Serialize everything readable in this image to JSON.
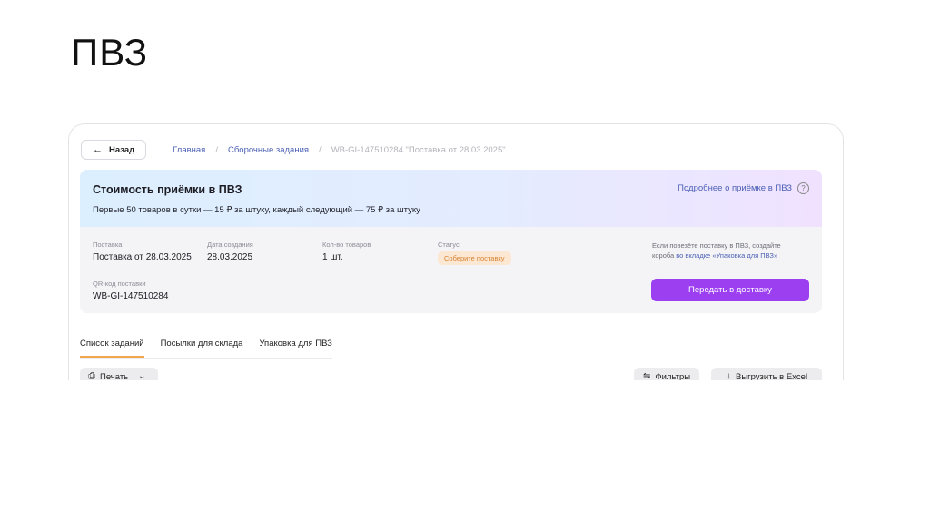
{
  "slide": {
    "title": "ПВЗ"
  },
  "header": {
    "back_label": "Назад",
    "breadcrumbs": [
      "Главная",
      "Сборочные задания",
      "WB-GI-147510284 \"Поставка от 28.03.2025\""
    ],
    "separator": "/"
  },
  "banner": {
    "title": "Стоимость приёмки в ПВЗ",
    "subtitle": "Первые 50 товаров в сутки — 15 ₽ за штуку, каждый следующий — 75 ₽ за штуку",
    "more_link": "Подробнее о приёмке в ПВЗ",
    "help_glyph": "?"
  },
  "details": {
    "supply": {
      "label": "Поставка",
      "value": "Поставка от 28.03.2025"
    },
    "created": {
      "label": "Дата создания",
      "value": "28.03.2025"
    },
    "quantity": {
      "label": "Кол-во товаров",
      "value": "1 шт."
    },
    "status": {
      "label": "Статус",
      "value": "Соберите поставку",
      "color": "#d6822f"
    },
    "qr": {
      "label": "QR-код поставки",
      "value": "WB-GI-147510284"
    }
  },
  "hint": {
    "text_before": "Если повезёте поставку в ПВЗ, создайте короба ",
    "link": "во вкладке «Упаковка для ПВЗ»"
  },
  "actions": {
    "send_label": "Передать в доставку",
    "print_label": "Печать",
    "filter_label": "Фильтры",
    "export_label": "Выгрузить в Excel"
  },
  "tabs": [
    {
      "label": "Список заданий",
      "active": true
    },
    {
      "label": "Посылки для склада",
      "active": false
    },
    {
      "label": "Упаковка для ПВЗ",
      "active": false
    }
  ],
  "colors": {
    "accent": "#9b3ff0",
    "link": "#4a5fb5",
    "tab_underline": "#f0a64a"
  }
}
